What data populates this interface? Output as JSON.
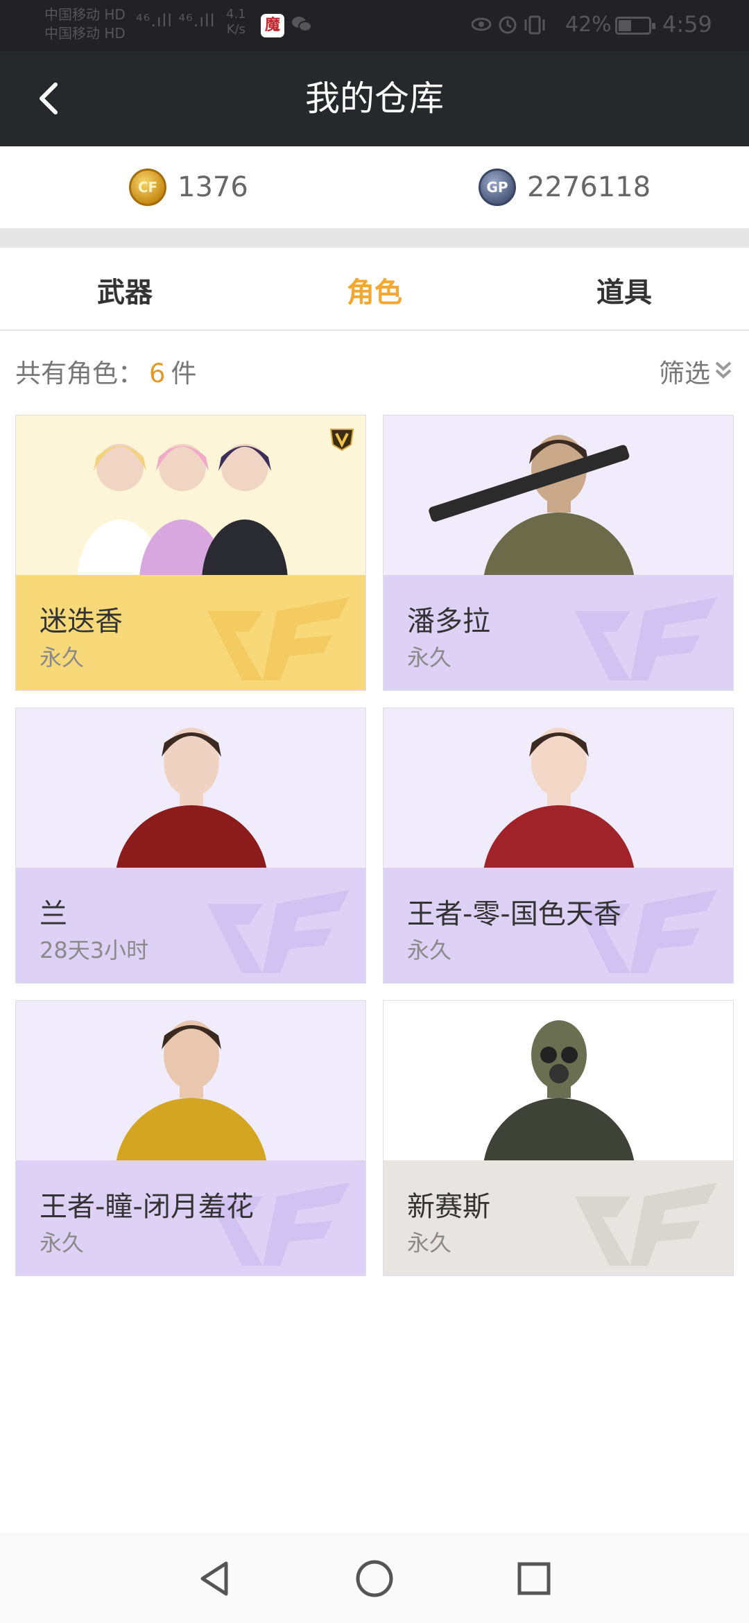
{
  "status_bar": {
    "carrier_1": "中国移动 HD",
    "carrier_2": "中国移动 HD",
    "signal": "⁴⁶.ıll ⁴⁶.ıll",
    "speed_value": "4.1",
    "speed_unit": "K/s",
    "battery_percent": "42%",
    "battery_level": 0.42,
    "time": "4:59"
  },
  "header": {
    "title": "我的仓库"
  },
  "currency": {
    "cf_icon_label": "CF",
    "cf_amount": "1376",
    "gp_icon_label": "GP",
    "gp_amount": "2276118"
  },
  "tabs": [
    {
      "label": "武器",
      "active": false
    },
    {
      "label": "角色",
      "active": true
    },
    {
      "label": "道具",
      "active": false
    }
  ],
  "summary": {
    "prefix": "共有角色：",
    "count": "6",
    "suffix": "件",
    "filter_label": "筛选"
  },
  "characters": [
    {
      "name": "迷迭香",
      "duration": "永久",
      "theme": "gold",
      "img_bg": "#fdf5d8",
      "info_bg": "#f8d97a",
      "watermark_color": "#efc14e",
      "vip": true
    },
    {
      "name": "潘多拉",
      "duration": "永久",
      "theme": "purple",
      "img_bg": "#f1ecfb",
      "info_bg": "#ddd1f5",
      "watermark_color": "#c9b6ee",
      "vip": false
    },
    {
      "name": "兰",
      "duration": "28天3小时",
      "theme": "purple",
      "img_bg": "#f1ecfb",
      "info_bg": "#ddd1f5",
      "watermark_color": "#c9b6ee",
      "vip": false
    },
    {
      "name": "王者-零-国色天香",
      "duration": "永久",
      "theme": "purple",
      "img_bg": "#f1ecfb",
      "info_bg": "#ddd1f5",
      "watermark_color": "#c9b6ee",
      "vip": false
    },
    {
      "name": "王者-瞳-闭月羞花",
      "duration": "永久",
      "theme": "purple",
      "img_bg": "#f1ecfb",
      "info_bg": "#ddd1f5",
      "watermark_color": "#c9b6ee",
      "vip": false
    },
    {
      "name": "新赛斯",
      "duration": "永久",
      "theme": "gray",
      "img_bg": "#ffffff",
      "info_bg": "#e7e4e1",
      "watermark_color": "#cfcac4",
      "vip": false
    }
  ],
  "icons": {
    "back": "back-arrow-icon",
    "filter": "chevron-double-down-icon",
    "nav_back": "triangle-back-icon",
    "nav_home": "circle-home-icon",
    "nav_recent": "square-recent-icon"
  }
}
